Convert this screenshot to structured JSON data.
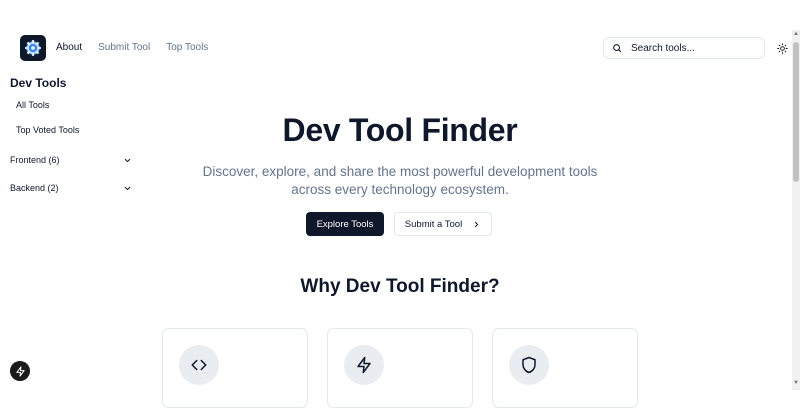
{
  "header": {
    "logo_icon": "gear-icon",
    "nav": [
      {
        "label": "About",
        "active": true
      },
      {
        "label": "Submit Tool",
        "active": false
      },
      {
        "label": "Top Tools",
        "active": false
      }
    ],
    "search": {
      "placeholder": "Search tools...",
      "icon": "search-icon"
    },
    "theme_icon": "sun-icon"
  },
  "sidebar": {
    "title": "Dev Tools",
    "items": [
      {
        "label": "All Tools"
      },
      {
        "label": "Top Voted Tools"
      }
    ],
    "groups": [
      {
        "label": "Frontend (6)",
        "icon": "chevron-down-icon"
      },
      {
        "label": "Backend (2)",
        "icon": "chevron-down-icon"
      }
    ]
  },
  "hero": {
    "title": "Dev Tool Finder",
    "subtitle": "Discover, explore, and share the most powerful development tools across every technology ecosystem.",
    "primary_button": "Explore Tools",
    "secondary_button": "Submit a Tool",
    "secondary_icon": "chevron-right-icon"
  },
  "features": {
    "title": "Why Dev Tool Finder?",
    "cards": [
      {
        "icon": "code-icon"
      },
      {
        "icon": "zap-icon"
      },
      {
        "icon": "shield-icon"
      }
    ]
  },
  "floating_button": {
    "icon": "zap-icon"
  },
  "colors": {
    "primary": "#0f172a",
    "muted_text": "#64748b",
    "border": "#e2e8f0",
    "icon_bg": "#e9ecf0"
  }
}
